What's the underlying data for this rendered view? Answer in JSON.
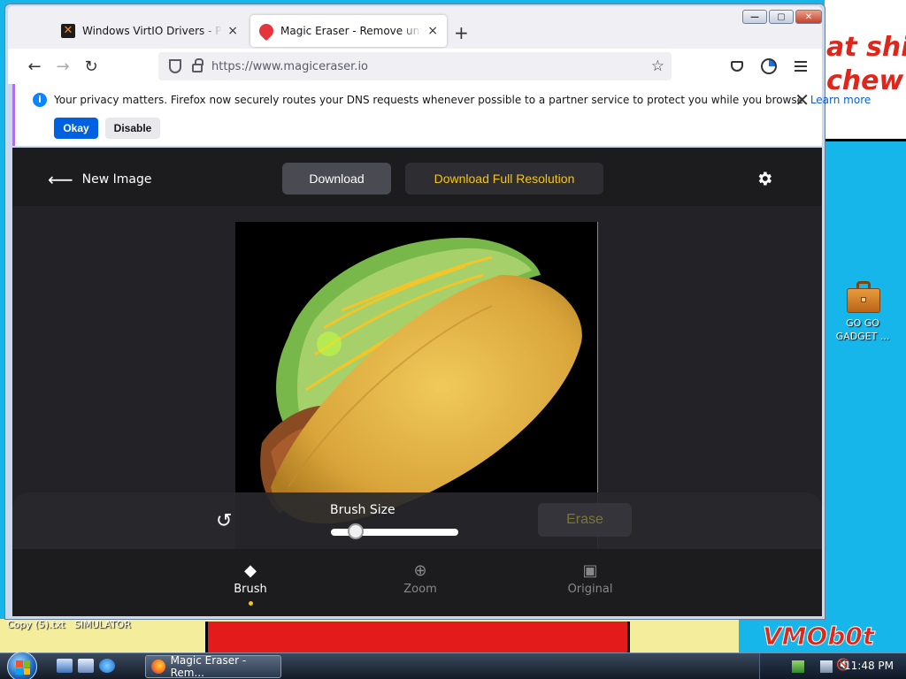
{
  "desktop": {
    "meme_line1": "at shi",
    "meme_line2": "chew",
    "file_label_1": "Copy (5).txt",
    "file_label_2": "SIMULATOR",
    "watermark": "VMOb0t",
    "icon_label_1": "GO GO",
    "icon_label_2": "GADGET ..."
  },
  "browser": {
    "tabs": [
      {
        "title": "Windows VirtIO Drivers - Proxmox",
        "close": "×"
      },
      {
        "title": "Magic Eraser - Remove unwanted",
        "close": "×"
      }
    ],
    "new_tab": "+",
    "window_controls": {
      "minimize": "—",
      "maximize": "▢",
      "close": "✕"
    },
    "url": "https://www.magiceraser.io",
    "notice": {
      "message": "Your privacy matters. Firefox now securely routes your DNS requests whenever possible to a partner service to protect you while you browse.",
      "learn_more": "Learn more",
      "okay": "Okay",
      "disable": "Disable"
    }
  },
  "app": {
    "new_image": "New Image",
    "download": "Download",
    "download_full": "Download Full Resolution",
    "brush_size_label": "Brush Size",
    "brush_size_value": 0.15,
    "erase": "Erase",
    "tabs": [
      {
        "label": "Brush",
        "icon": "eraser-icon"
      },
      {
        "label": "Zoom",
        "icon": "zoom-in-icon"
      },
      {
        "label": "Original",
        "icon": "image-icon"
      }
    ],
    "colors": {
      "accent": "#f5c518",
      "bg": "#1c1c1f"
    }
  },
  "taskbar": {
    "task_label": "Magic Eraser - Rem...",
    "clock": "11:48 PM"
  }
}
